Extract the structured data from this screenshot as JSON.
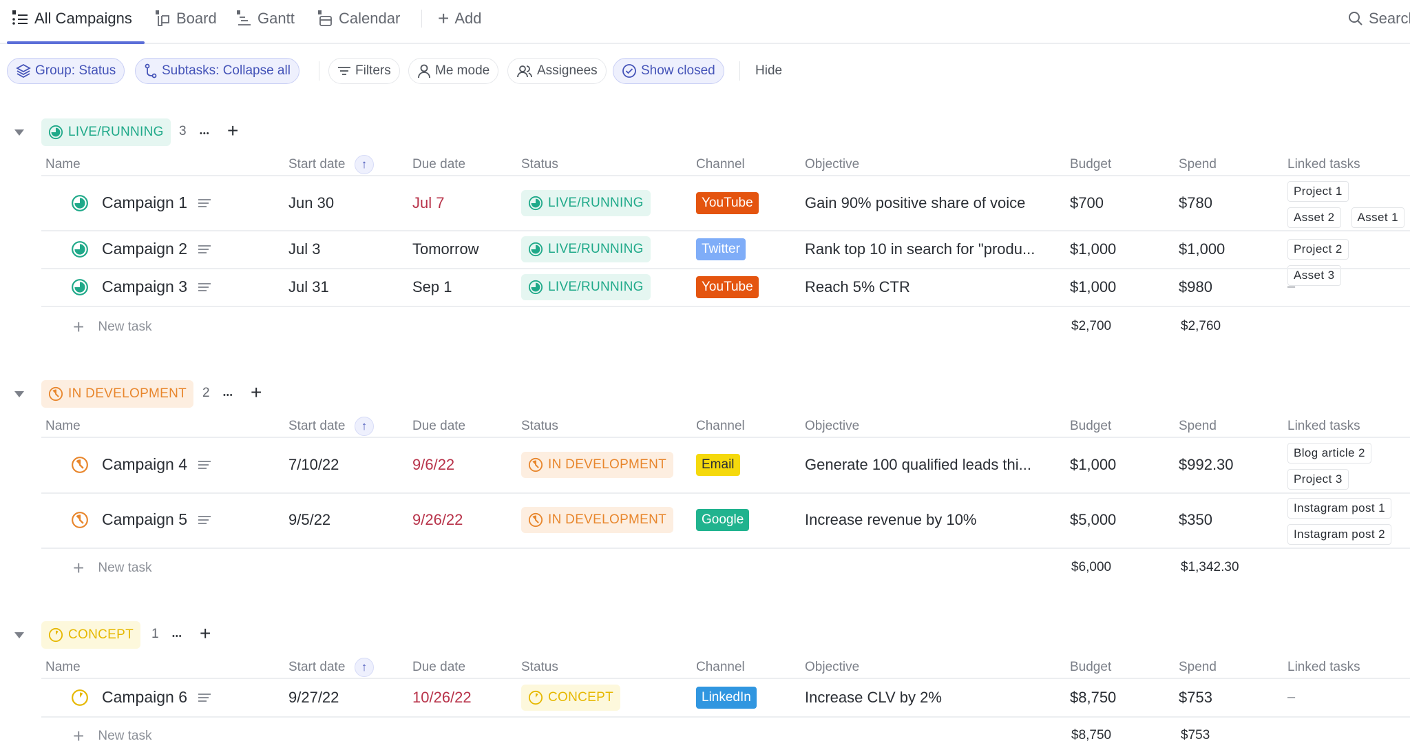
{
  "tabs": [
    {
      "label": "All Campaigns",
      "icon": "list-icon",
      "active": true
    },
    {
      "label": "Board",
      "icon": "board-icon"
    },
    {
      "label": "Gantt",
      "icon": "gantt-icon"
    },
    {
      "label": "Calendar",
      "icon": "calendar-icon"
    },
    {
      "label": "Add",
      "icon": "plus-icon"
    }
  ],
  "search": {
    "label": "Search"
  },
  "toolbar": {
    "group": "Group: Status",
    "subtasks": "Subtasks: Collapse all",
    "filters": "Filters",
    "me_mode": "Me mode",
    "assignees": "Assignees",
    "show_closed": "Show closed",
    "hide": "Hide"
  },
  "columns": {
    "name": "Name",
    "start": "Start date",
    "due": "Due date",
    "status": "Status",
    "channel": "Channel",
    "objective": "Objective",
    "budget": "Budget",
    "spend": "Spend",
    "linked": "Linked tasks"
  },
  "new_task_label": "New task",
  "colors": {
    "live": "#1fa989",
    "dev": "#e8862c",
    "concept": "#e6b800",
    "accent": "#5b6ed8",
    "overdue": "#b8334a"
  },
  "groups": [
    {
      "status": "LIVE/RUNNING",
      "count": "3",
      "tasks": [
        {
          "name": "Campaign 1",
          "start": "Jun 30",
          "due": "Jul 7",
          "due_overdue": true,
          "status": "LIVE/RUNNING",
          "channel": "YouTube",
          "objective": "Gain 90% positive share of voice",
          "budget": "$700",
          "spend": "$780",
          "linked": [
            "Project 1",
            "Asset 2",
            "Asset 1"
          ]
        },
        {
          "name": "Campaign 2",
          "start": "Jul 3",
          "due": "Tomorrow",
          "due_overdue": false,
          "status": "LIVE/RUNNING",
          "channel": "Twitter",
          "objective": "Rank top 10 in search for \"produ...",
          "budget": "$1,000",
          "spend": "$1,000",
          "linked": [
            "Project 2",
            "Asset 3"
          ]
        },
        {
          "name": "Campaign 3",
          "start": "Jul 31",
          "due": "Sep 1",
          "due_overdue": false,
          "status": "LIVE/RUNNING",
          "channel": "YouTube",
          "objective": "Reach 5% CTR",
          "budget": "$1,000",
          "spend": "$980",
          "linked": "–"
        }
      ],
      "total_budget": "$2,700",
      "total_spend": "$2,760"
    },
    {
      "status": "IN DEVELOPMENT",
      "count": "2",
      "tasks": [
        {
          "name": "Campaign 4",
          "start": "7/10/22",
          "due": "9/6/22",
          "due_overdue": true,
          "status": "IN DEVELOPMENT",
          "channel": "Email",
          "objective": "Generate 100 qualified leads thi...",
          "budget": "$1,000",
          "spend": "$992.30",
          "linked": [
            "Blog article 2",
            "Project 3"
          ]
        },
        {
          "name": "Campaign 5",
          "start": "9/5/22",
          "due": "9/26/22",
          "due_overdue": true,
          "status": "IN DEVELOPMENT",
          "channel": "Google",
          "objective": "Increase revenue by 10%",
          "budget": "$5,000",
          "spend": "$350",
          "linked": [
            "Instagram post 1",
            "Instagram post 2"
          ]
        }
      ],
      "total_budget": "$6,000",
      "total_spend": "$1,342.30"
    },
    {
      "status": "CONCEPT",
      "count": "1",
      "tasks": [
        {
          "name": "Campaign 6",
          "start": "9/27/22",
          "due": "10/26/22",
          "due_overdue": true,
          "status": "CONCEPT",
          "channel": "LinkedIn",
          "objective": "Increase CLV by 2%",
          "budget": "$8,750",
          "spend": "$753",
          "linked": "–"
        }
      ],
      "total_budget": "$8,750",
      "total_spend": "$753"
    }
  ],
  "channel_colors": {
    "YouTube": "#e4540f",
    "Twitter": "#7fadf8",
    "Email": "#f5d90c",
    "Google": "#20b38e",
    "LinkedIn": "#3096e0"
  }
}
